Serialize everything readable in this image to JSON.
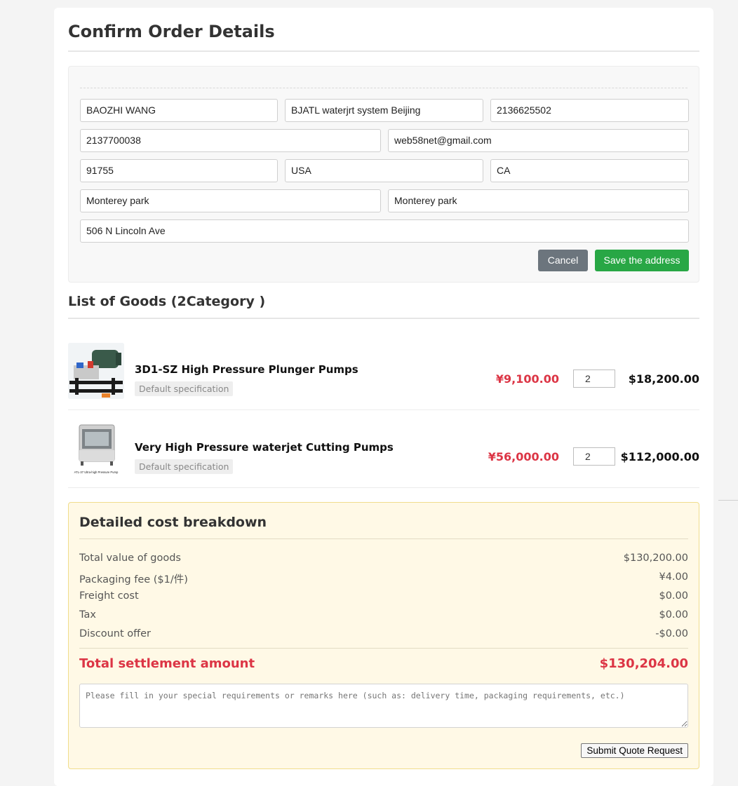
{
  "page": {
    "title": "Confirm Order Details"
  },
  "address": {
    "name": "BAOZHI WANG",
    "company": "BJATL waterjrt system Beijing",
    "phone": "2136625502",
    "fax": "2137700038",
    "email": "web58net@gmail.com",
    "zip": "91755",
    "country": "USA",
    "state": "CA",
    "city": "Monterey park",
    "district": "Monterey park",
    "street": "506 N Lincoln Ave",
    "cancel_label": "Cancel",
    "save_label": "Save the address"
  },
  "goods": {
    "title": "List of Goods (2Category )",
    "items": [
      {
        "name": "3D1-SZ High Pressure Plunger Pumps",
        "spec": "Default specification",
        "unit_price": "¥9,100.00",
        "qty": "2",
        "total": "$18,200.00",
        "image": "pump-thumbnail"
      },
      {
        "name": "Very High Pressure waterjet Cutting Pumps",
        "spec": "Default specification",
        "unit_price": "¥56,000.00",
        "qty": "2",
        "total": "$112,000.00",
        "image": "waterjet-pump-cabinet-thumbnail",
        "image_caption": "ATL-37 Ultra-high Pressure Pump"
      }
    ]
  },
  "costs": {
    "title": "Detailed cost breakdown",
    "lines": [
      {
        "label": "Total value of goods",
        "value": "$130,200.00"
      },
      {
        "label": "Packaging fee ($1/件)",
        "value": "¥4.00"
      },
      {
        "label": "Freight cost",
        "value": "$0.00"
      },
      {
        "label": "Tax",
        "value": "$0.00"
      },
      {
        "label": "Discount offer",
        "value": "-$0.00"
      }
    ],
    "total_label": "Total settlement amount",
    "total_value": "$130,204.00",
    "remarks_placeholder": "Please fill in your special requirements or remarks here (such as: delivery time, packaging requirements, etc.)",
    "submit_label": "Submit Quote Request"
  },
  "colors": {
    "accent_red": "#dc3545",
    "save_green": "#28a745",
    "cancel_gray": "#6c757d",
    "cost_panel_bg": "#fff9e6"
  }
}
